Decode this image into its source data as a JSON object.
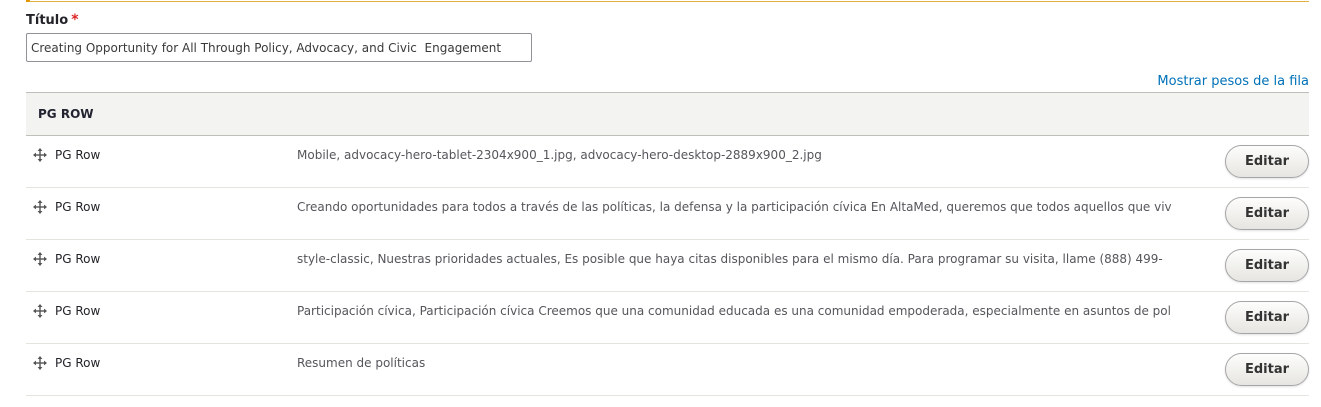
{
  "form": {
    "title_label": "Título",
    "required_marker": "*",
    "title_value": "Creating Opportunity for All Through Policy, Advocacy, and Civic  Engagement"
  },
  "table": {
    "show_weights_link": "Mostrar pesos de la fila",
    "header": "PG ROW",
    "edit_label": "Editar",
    "rows": [
      {
        "label": "PG Row",
        "summary": "Mobile, advocacy-hero-tablet-2304x900_1.jpg, advocacy-hero-desktop-2889x900_2.jpg"
      },
      {
        "label": "PG Row",
        "summary": "Creando oportunidades para todos a través de las políticas, la defensa y la participación cívica En AltaMed, queremos que todos aquellos que viv"
      },
      {
        "label": "PG Row",
        "summary": "style-classic, Nuestras prioridades actuales, Es posible que haya citas disponibles para el mismo día. Para programar su visita, llame (888) 499-"
      },
      {
        "label": "PG Row",
        "summary": "Participación cívica, Participación cívica Creemos que una comunidad educada es una comunidad empoderada, especialmente en asuntos de pol"
      },
      {
        "label": "PG Row",
        "summary": "Resumen de políticas"
      }
    ]
  },
  "icons": {
    "drag_handle": "move-arrows-icon"
  },
  "colors": {
    "link": "#0071b8",
    "required": "#dc2323",
    "warning_strip": "#e09600"
  }
}
